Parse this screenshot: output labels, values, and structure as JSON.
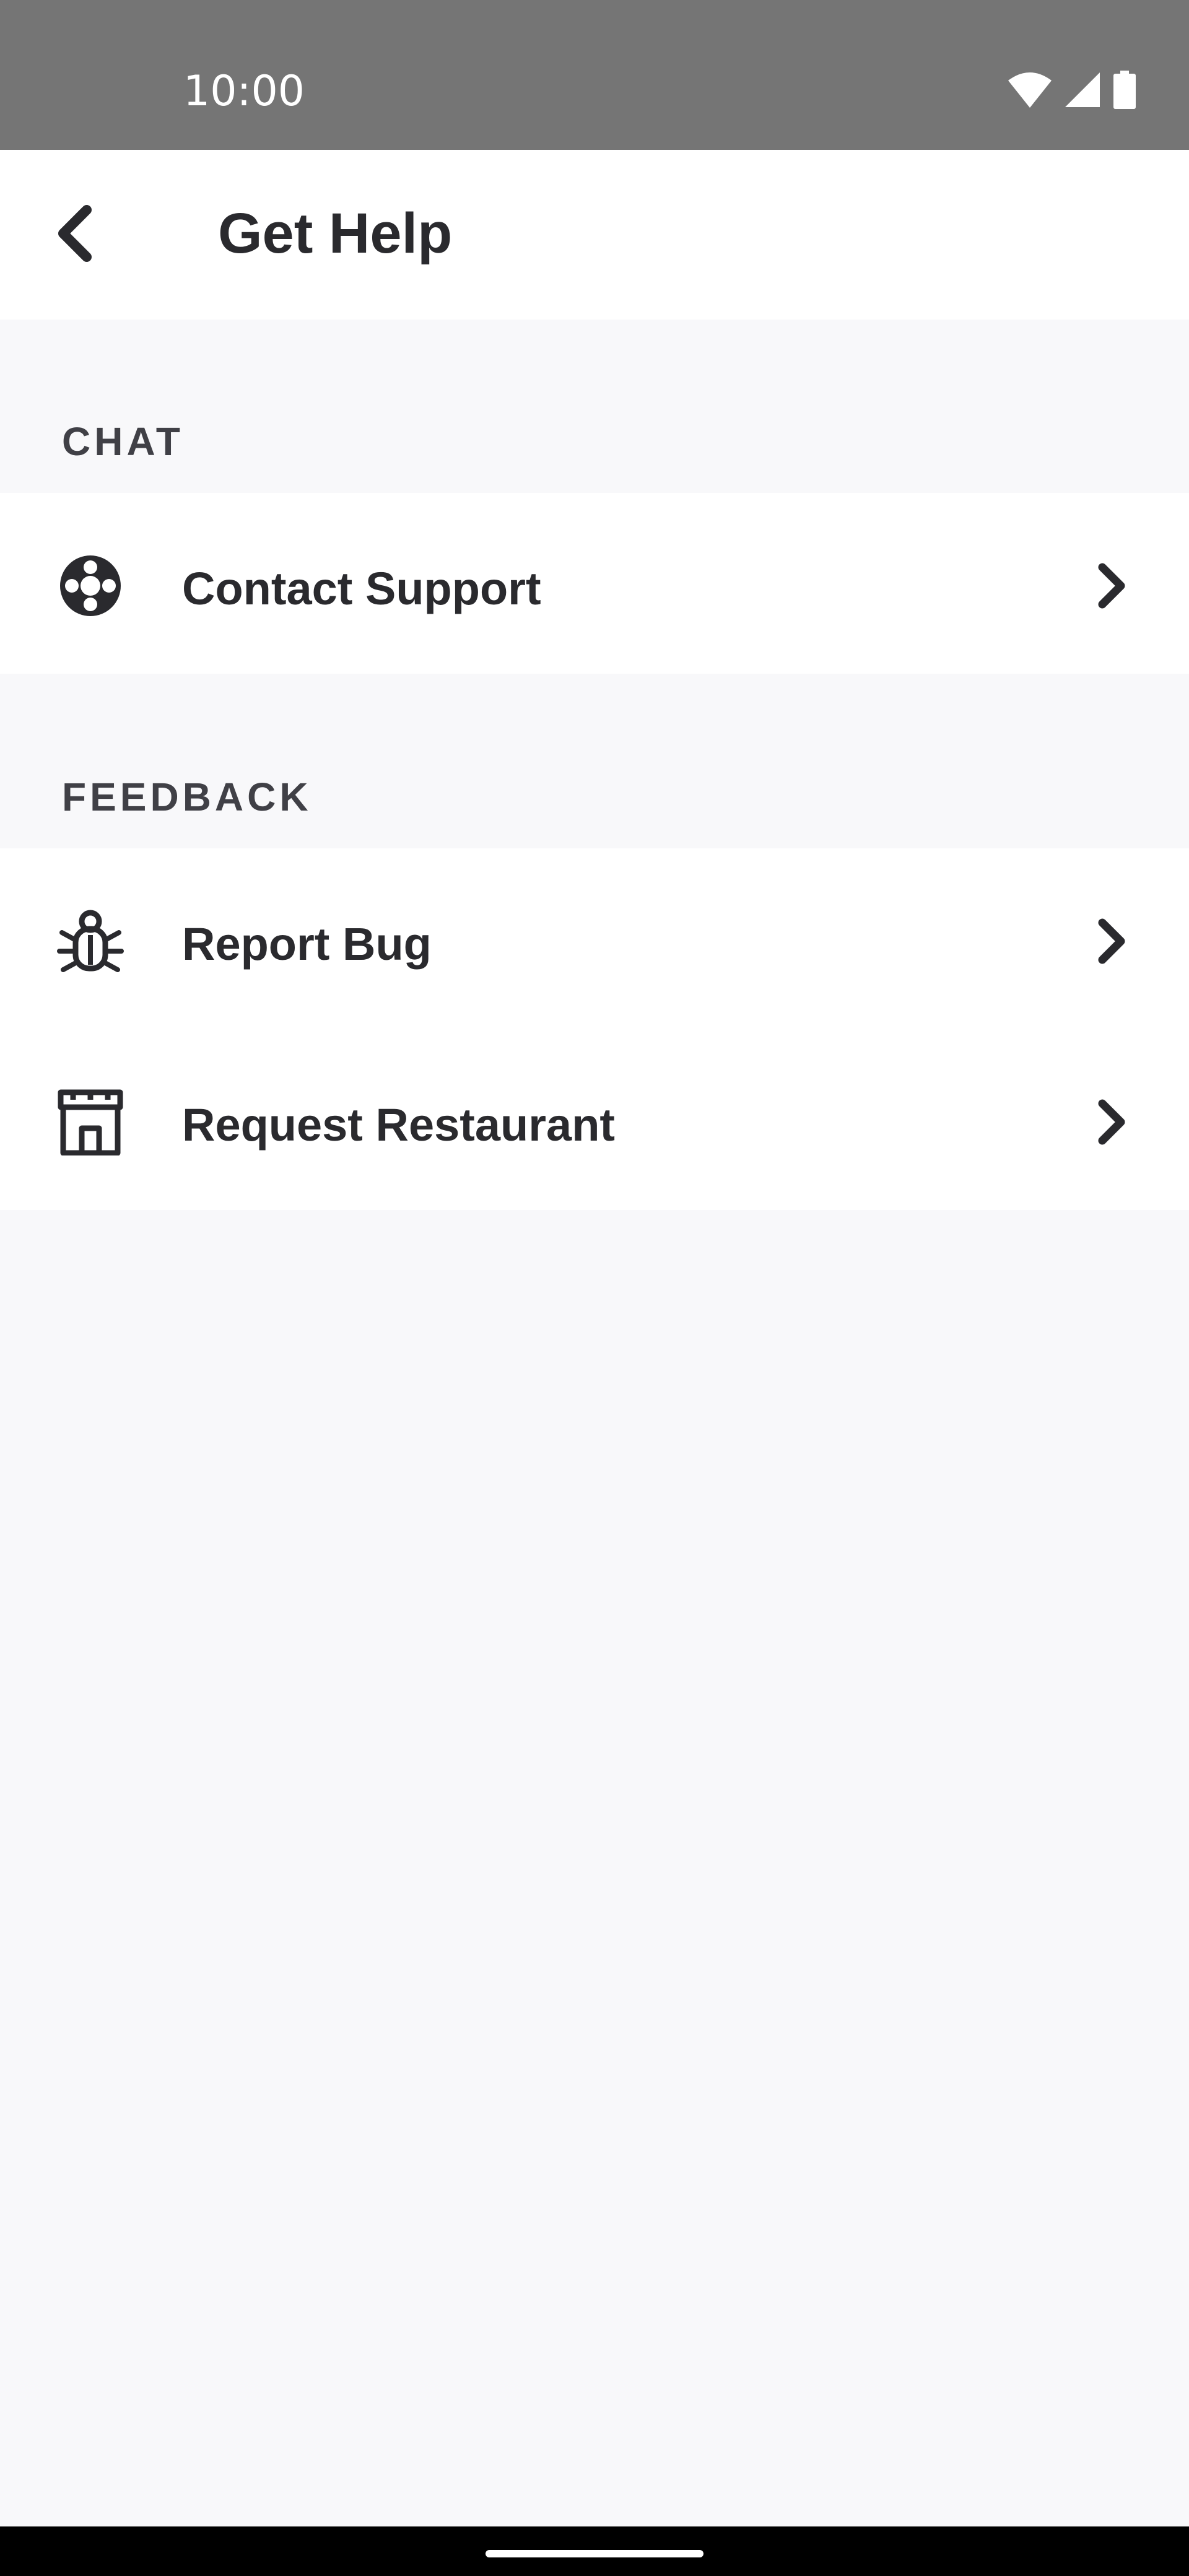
{
  "status_bar": {
    "time": "10:00",
    "icons": [
      "wifi-icon",
      "cellular-signal-icon",
      "battery-icon"
    ]
  },
  "header": {
    "back_icon": "chevron-left-icon",
    "title": "Get Help"
  },
  "sections": [
    {
      "title": "CHAT",
      "items": [
        {
          "label": "Contact Support",
          "icon": "lifebuoy-icon"
        }
      ]
    },
    {
      "title": "FEEDBACK",
      "items": [
        {
          "label": "Report Bug",
          "icon": "bug-icon"
        },
        {
          "label": "Request Restaurant",
          "icon": "storefront-icon"
        }
      ]
    }
  ],
  "colors": {
    "status_bar": "#757575",
    "background": "#f8f8fa",
    "surface": "#ffffff",
    "text": "#2a2a2e"
  }
}
